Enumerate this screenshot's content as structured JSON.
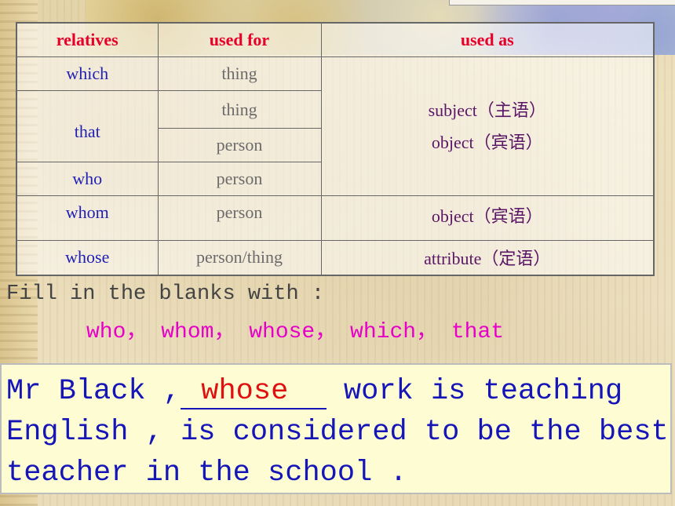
{
  "table": {
    "headers": [
      "relatives",
      "used for",
      "used as"
    ],
    "rows": {
      "which": {
        "rel": "which",
        "for": "thing"
      },
      "that": {
        "rel": "that",
        "for1": "thing",
        "for2": "person"
      },
      "who": {
        "rel": "who",
        "for": "person"
      },
      "whom": {
        "rel": "whom",
        "for": "person",
        "as": "object（宾语）"
      },
      "whose": {
        "rel": "whose",
        "for": "person/thing",
        "as": "attribute（定语）"
      }
    },
    "used_as_group": [
      "subject（主语）",
      "object（宾语）"
    ]
  },
  "instructions": {
    "label": "Fill in the blanks with :",
    "words": "who， whom， whose， which， that"
  },
  "question": {
    "before": "Mr Black ,",
    "answer": "whose",
    "line1_after": " work is teaching",
    "line2": "English , is considered to be the best",
    "line3": "teacher in the school ."
  },
  "colors": {
    "header": "#e8002a",
    "relative": "#1f1fb4",
    "used_for": "#6b6b6b",
    "used_as": "#5a1565",
    "word_list": "#e600c8",
    "question_text": "#1515b8",
    "answer": "#e01010",
    "question_bg": "#fdfcd2"
  }
}
